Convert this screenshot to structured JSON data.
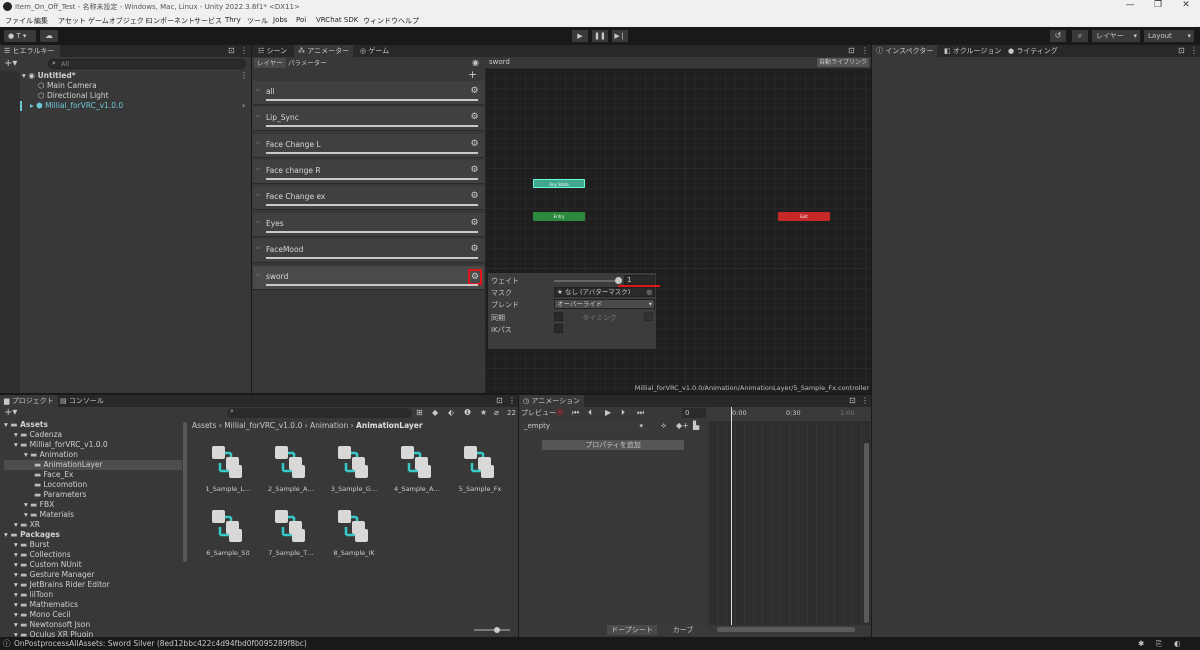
{
  "window": {
    "title": "Item_On_Off_Test - 名称未設定 - Windows, Mac, Linux - Unity 2022.3.6f1* <DX11>"
  },
  "menu": [
    "ファイル",
    "編集",
    "アセット",
    "ゲームオブジェクト",
    "コンポーネント",
    "サービス",
    "Thry",
    "ツール",
    "Jobs",
    "Poi",
    "VRChat SDK",
    "ウィンドウ",
    "ヘルプ"
  ],
  "toolbar": {
    "account": "T",
    "layers": "レイヤー",
    "layout": "Layout"
  },
  "hierarchy": {
    "tab": "ヒエラルキー",
    "search_placeholder": "All",
    "scene": "Untitled*",
    "items": [
      "Main Camera",
      "Directional Light",
      "Millial_forVRC_v1.0.0"
    ]
  },
  "center_tabs": [
    "シーン",
    "アニメーター",
    "ゲーム"
  ],
  "animator": {
    "subtabs": [
      "レイヤー",
      "パラメーター"
    ],
    "layers": [
      "all",
      "Lip_Sync",
      "Face Change L",
      "Face change R",
      "Face Change ex",
      "Eyes",
      "FaceMood",
      "sword"
    ],
    "breadcrumb": "sword",
    "auto_live": "自動ライブリンク",
    "nodes": {
      "any": "Any State",
      "entry": "Entry",
      "exit": "Exit"
    },
    "path": "Millial_forVRC_v1.0.0/Animation/AnimationLayer/5_Sample_Fx.controller",
    "popup": {
      "weight_label": "ウェイト",
      "weight_value": "1",
      "mask_label": "マスク",
      "mask_value": "なし (アバターマスク)",
      "blend_label": "ブレンド",
      "blend_value": "オーバーライド",
      "sync_label": "同期",
      "timing_label": "タイミング",
      "ik_label": "IKパス"
    }
  },
  "right_tabs": [
    "インスペクター",
    "オクルージョン",
    "ライティング"
  ],
  "project": {
    "tabs": [
      "プロジェクト",
      "コンソール"
    ],
    "count": "22",
    "breadcrumb": [
      "Assets",
      "Millial_forVRC_v1.0.0",
      "Animation",
      "AnimationLayer"
    ],
    "tree": [
      {
        "label": "Assets",
        "indent": 0,
        "bold": true
      },
      {
        "label": "Cadenza",
        "indent": 1
      },
      {
        "label": "Millial_forVRC_v1.0.0",
        "indent": 1
      },
      {
        "label": "Animation",
        "indent": 2
      },
      {
        "label": "AnimationLayer",
        "indent": 3,
        "selected": true
      },
      {
        "label": "Face_Ex",
        "indent": 3
      },
      {
        "label": "Locomotion",
        "indent": 3
      },
      {
        "label": "Parameters",
        "indent": 3
      },
      {
        "label": "FBX",
        "indent": 2
      },
      {
        "label": "Materials",
        "indent": 2
      },
      {
        "label": "XR",
        "indent": 1
      },
      {
        "label": "Packages",
        "indent": 0,
        "bold": true
      },
      {
        "label": "Burst",
        "indent": 1
      },
      {
        "label": "Collections",
        "indent": 1
      },
      {
        "label": "Custom NUnit",
        "indent": 1
      },
      {
        "label": "Gesture Manager",
        "indent": 1
      },
      {
        "label": "JetBrains Rider Editor",
        "indent": 1
      },
      {
        "label": "lilToon",
        "indent": 1
      },
      {
        "label": "Mathematics",
        "indent": 1
      },
      {
        "label": "Mono Cecil",
        "indent": 1
      },
      {
        "label": "Newtonsoft Json",
        "indent": 1
      },
      {
        "label": "Oculus XR Plugin",
        "indent": 1
      }
    ],
    "assets": [
      "1_Sample_L…",
      "2_Sample_A…",
      "3_Sample_G…",
      "4_Sample_A…",
      "5_Sample_Fx",
      "6_Sample_Sit",
      "7_Sample_T…",
      "8_Sample_IK"
    ]
  },
  "animation": {
    "tab": "アニメーション",
    "preview": "プレビュー",
    "frame": "0",
    "clip": "_empty",
    "add_property": "プロパティを追加",
    "dopesheet": "ドープシート",
    "curves": "カーブ",
    "ruler": [
      "0:00",
      "0:30",
      "1:00"
    ]
  },
  "status": {
    "text": "OnPostprocessAllAssets: Sword Silver (8ed12bbc422c4d94fbd0f0095289f8bc)"
  },
  "colors": {
    "accent_red": "#e0161b",
    "entry": "#2b8a3e",
    "exit": "#c62828",
    "anystate": "#3fa88d",
    "asset_line": "#37c8c8"
  }
}
